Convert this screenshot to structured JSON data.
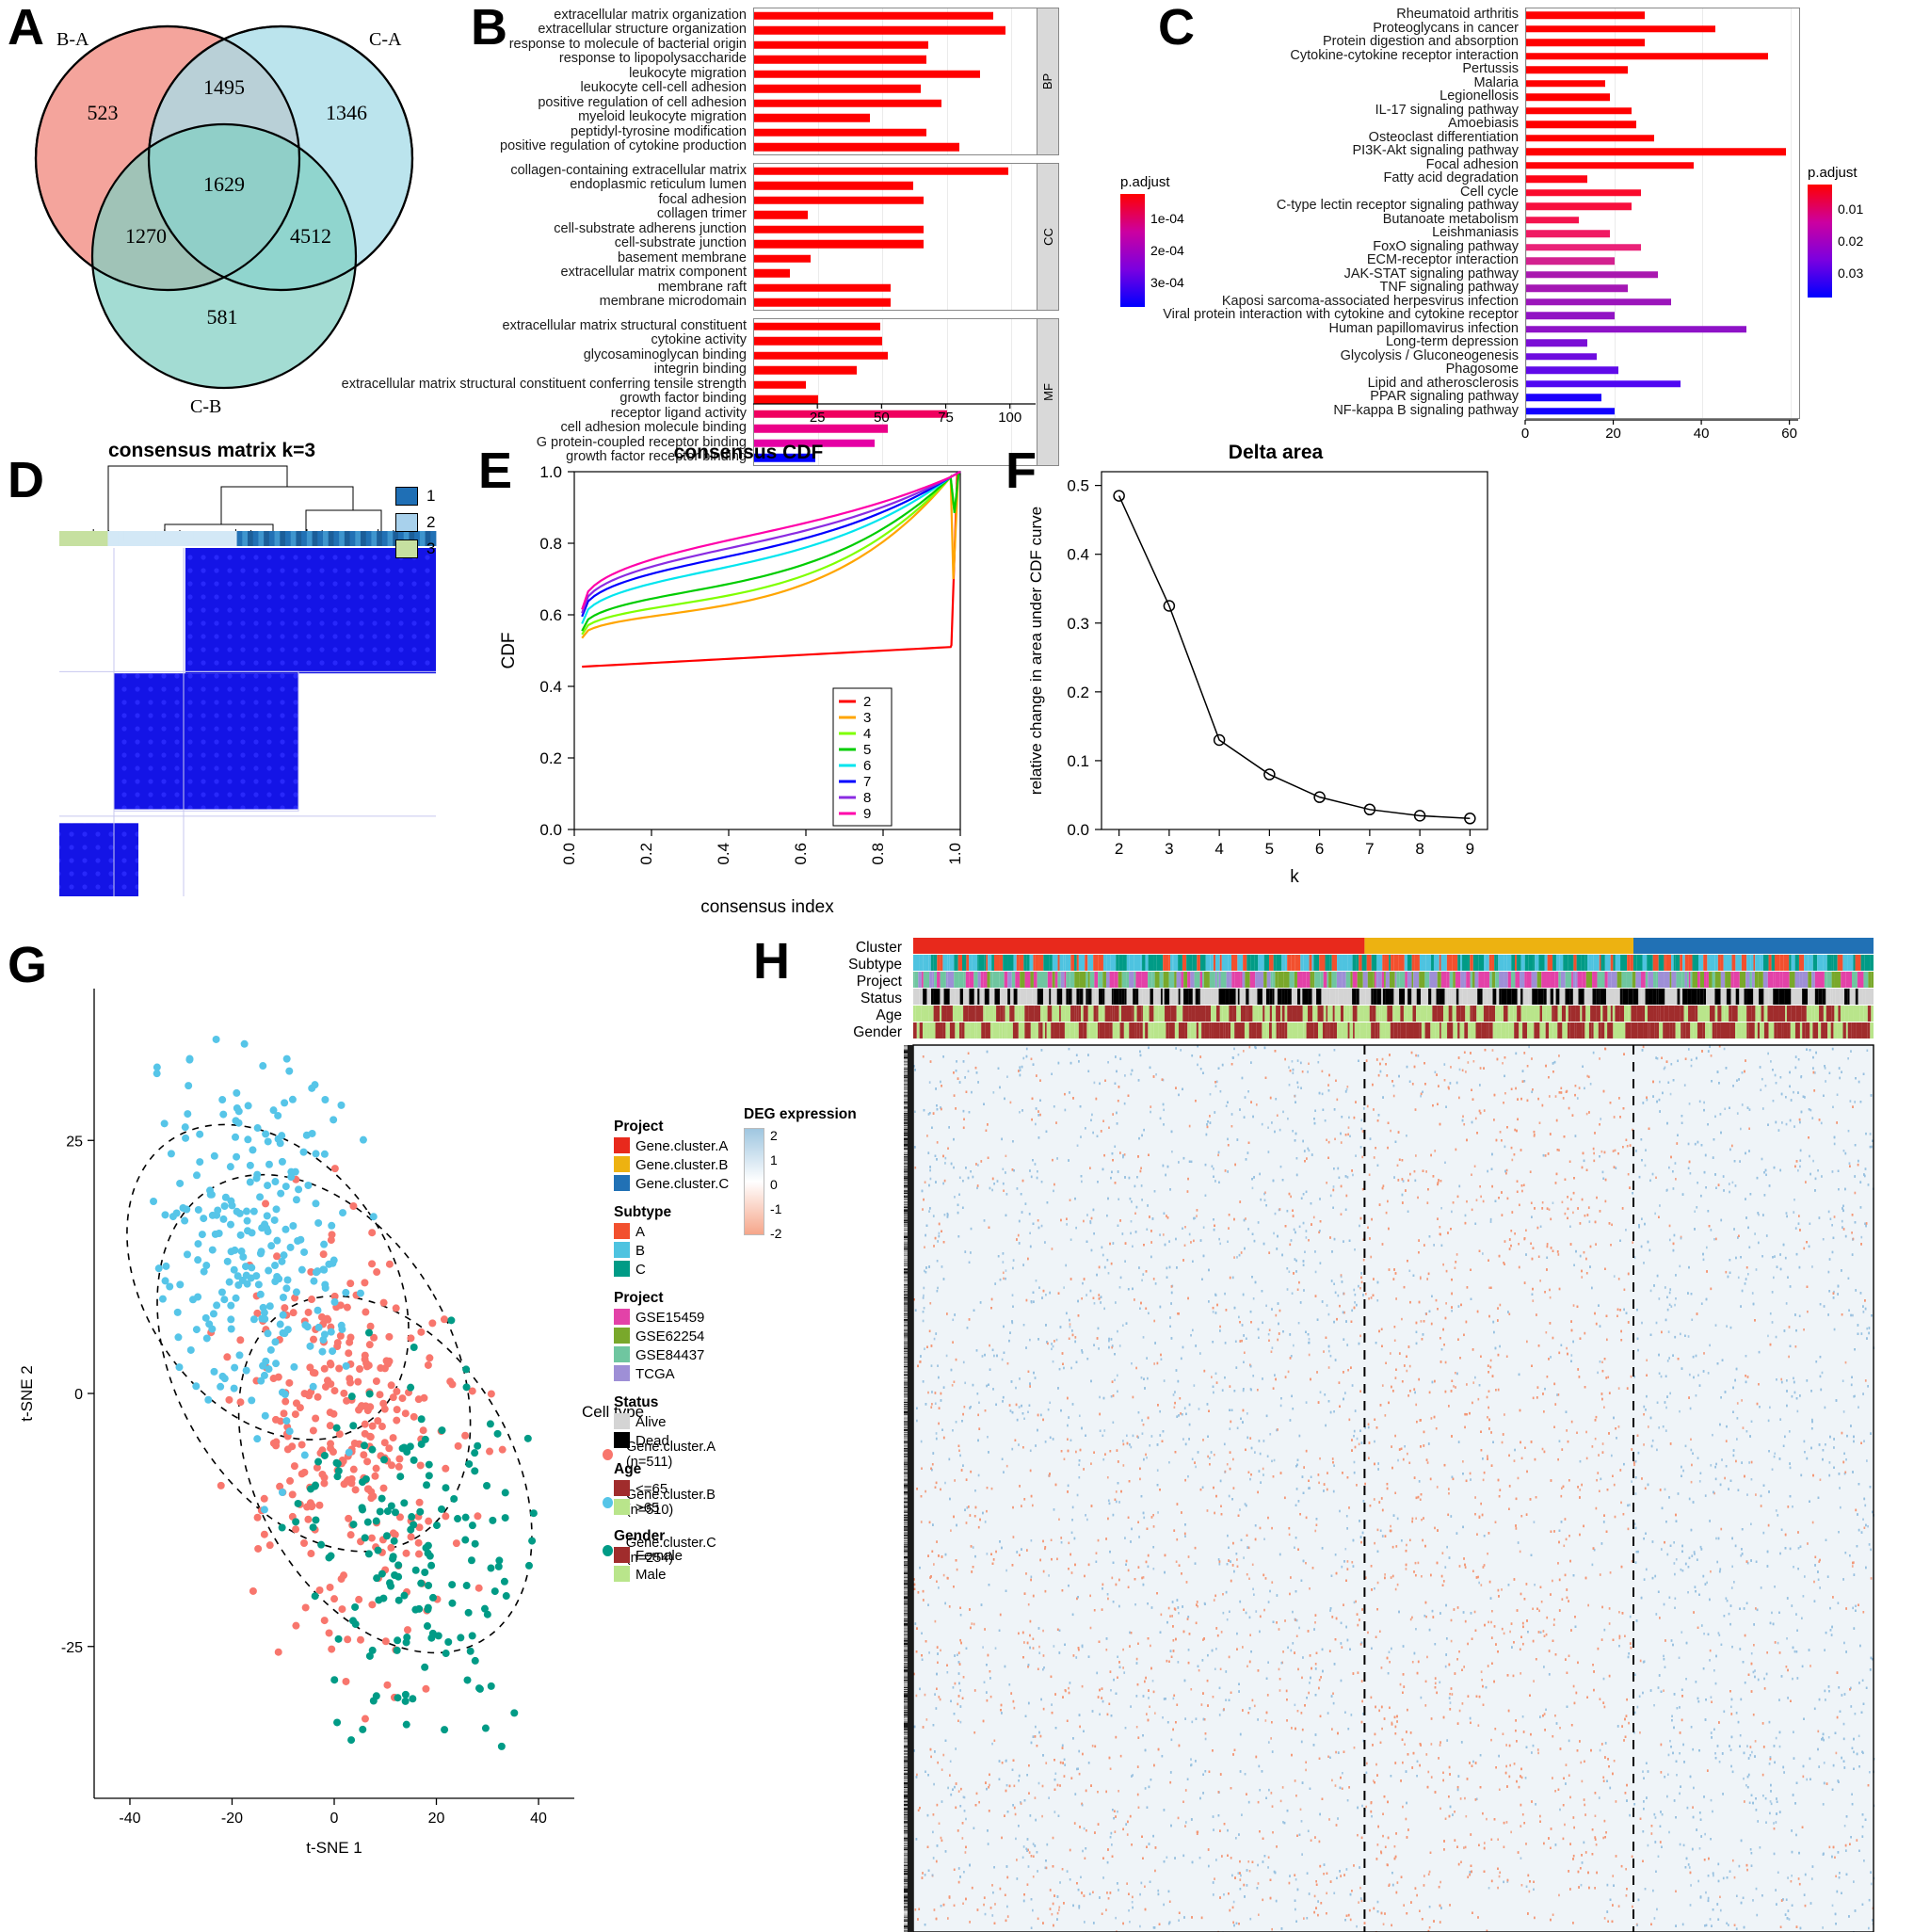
{
  "panels": {
    "A": {
      "label": "A"
    },
    "B": {
      "label": "B"
    },
    "C": {
      "label": "C"
    },
    "D": {
      "label": "D"
    },
    "E": {
      "label": "E"
    },
    "F": {
      "label": "F"
    },
    "G": {
      "label": "G"
    },
    "H": {
      "label": "H"
    }
  },
  "venn": {
    "set_labels": [
      "B-A",
      "C-A",
      "C-B"
    ],
    "values": {
      "only_BA": "523",
      "only_CA": "1346",
      "only_CB": "581",
      "BA_CA": "1495",
      "BA_CB": "1270",
      "CA_CB": "4512",
      "all_three": "1629"
    },
    "colors": {
      "BA": "#F2948B",
      "CA": "#A8DCE8",
      "CB": "#7FCFC2"
    }
  },
  "chart_data": [
    {
      "id": "panelB",
      "type": "bar",
      "title": "",
      "xlabel": "",
      "ylabel": "",
      "xlim": [
        0,
        110
      ],
      "xticks": [
        25,
        50,
        75,
        100
      ],
      "grid": true,
      "legend": {
        "title": "p.adjust",
        "position": "right",
        "ticks": [
          "1e-04",
          "2e-04",
          "3e-04"
        ],
        "colors": [
          "#FF0000",
          "#CC00A0",
          "#7B00E0",
          "#0000FF"
        ]
      },
      "facets": [
        {
          "name": "BP",
          "categories": [
            "extracellular matrix organization",
            "extracellular structure organization",
            "response to molecule of bacterial origin",
            "response to lipopolysaccharide",
            "leukocyte migration",
            "leukocyte cell-cell adhesion",
            "positive regulation of cell adhesion",
            "myeloid leukocyte migration",
            "peptidyl-tyrosine modification",
            "positive regulation of cytokine production"
          ],
          "values": [
            93,
            98,
            68,
            67,
            88,
            65,
            73,
            45,
            67,
            80
          ],
          "colors": [
            "#FF0000",
            "#FF0000",
            "#FF0000",
            "#FF0000",
            "#FF0000",
            "#FF0000",
            "#FF0000",
            "#FF0000",
            "#FF0000",
            "#FF0000"
          ]
        },
        {
          "name": "CC",
          "categories": [
            "collagen-containing extracellular matrix",
            "endoplasmic reticulum lumen",
            "focal adhesion",
            "collagen trimer",
            "cell-substrate adherens junction",
            "cell-substrate junction",
            "basement membrane",
            "extracellular matrix component",
            "membrane raft",
            "membrane microdomain"
          ],
          "values": [
            99,
            62,
            66,
            21,
            66,
            66,
            22,
            14,
            53,
            53
          ],
          "colors": [
            "#FF0000",
            "#FF0000",
            "#FF0000",
            "#FF0000",
            "#FF0000",
            "#FF0000",
            "#FF0000",
            "#FF0000",
            "#FF0000",
            "#FF0000"
          ]
        },
        {
          "name": "MF",
          "categories": [
            "extracellular matrix structural constituent",
            "cytokine activity",
            "glycosaminoglycan binding",
            "integrin binding",
            "extracellular matrix structural constituent conferring tensile strength",
            "growth factor binding",
            "receptor ligand activity",
            "cell adhesion molecule binding",
            "G protein-coupled receptor binding",
            "growth factor receptor binding"
          ],
          "values": [
            49,
            50,
            52,
            40,
            20,
            25,
            75,
            52,
            47,
            24
          ],
          "colors": [
            "#FF0000",
            "#FF0000",
            "#FF0000",
            "#FF0000",
            "#FF0000",
            "#FF0000",
            "#F0005F",
            "#EB0088",
            "#E500A5",
            "#0000FF"
          ]
        }
      ]
    },
    {
      "id": "panelC",
      "type": "bar",
      "title": "",
      "xlabel": "",
      "xlim": [
        0,
        62
      ],
      "xticks": [
        0,
        20,
        40,
        60
      ],
      "grid": true,
      "legend": {
        "title": "p.adjust",
        "position": "right",
        "ticks": [
          "0.01",
          "0.02",
          "0.03"
        ],
        "colors": [
          "#FF0000",
          "#CC00A0",
          "#7B00E0",
          "#0000FF"
        ]
      },
      "categories": [
        "Rheumatoid arthritis",
        "Proteoglycans in cancer",
        "Protein digestion and absorption",
        "Cytokine-cytokine receptor interaction",
        "Pertussis",
        "Malaria",
        "Legionellosis",
        "IL-17 signaling pathway",
        "Amoebiasis",
        "Osteoclast differentiation",
        "PI3K-Akt signaling pathway",
        "Focal adhesion",
        "Fatty acid degradation",
        "Cell cycle",
        "C-type lectin receptor signaling pathway",
        "Butanoate metabolism",
        "Leishmaniasis",
        "FoxO signaling pathway",
        "ECM-receptor interaction",
        "JAK-STAT signaling pathway",
        "TNF signaling pathway",
        "Kaposi sarcoma-associated herpesvirus infection",
        "Viral protein interaction with cytokine and cytokine receptor",
        "Human papillomavirus infection",
        "Long-term depression",
        "Glycolysis / Gluconeogenesis",
        "Phagosome",
        "Lipid and atherosclerosis",
        "PPAR signaling pathway",
        "NF-kappa B signaling pathway"
      ],
      "values": [
        27,
        43,
        27,
        55,
        23,
        18,
        19,
        24,
        25,
        29,
        59,
        38,
        14,
        26,
        24,
        12,
        19,
        26,
        20,
        30,
        23,
        33,
        20,
        50,
        14,
        16,
        21,
        35,
        17,
        20
      ],
      "colors": [
        "#FF0000",
        "#FF0000",
        "#FF0000",
        "#FF0000",
        "#FF0000",
        "#FF0000",
        "#FF0000",
        "#FF0000",
        "#FF0000",
        "#FF0000",
        "#FF0000",
        "#FF0207",
        "#FE0415",
        "#FA0A2C",
        "#F70F3D",
        "#F4144E",
        "#F01963",
        "#EA2278",
        "#D3218F",
        "#A918AF",
        "#A417B4",
        "#9B15BB",
        "#9113C4",
        "#8E12C7",
        "#7A0ED6",
        "#6E0CDF",
        "#5F09E9",
        "#4F06F2",
        "#1B00FB",
        "#1200FF"
      ]
    },
    {
      "id": "panelE",
      "type": "line",
      "title": "consensus CDF",
      "xlabel": "consensus index",
      "ylabel": "CDF",
      "xlim": [
        0,
        1
      ],
      "ylim": [
        0,
        1
      ],
      "xticks": [
        "0.0",
        "0.2",
        "0.4",
        "0.6",
        "0.8",
        "1.0"
      ],
      "yticks": [
        "0.0",
        "0.2",
        "0.4",
        "0.6",
        "0.8",
        "1.0"
      ],
      "legend": {
        "position": "bottom-right",
        "entries": [
          "2",
          "3",
          "4",
          "5",
          "6",
          "7",
          "8",
          "9"
        ],
        "colors": [
          "#FF0000",
          "#FFA500",
          "#7FFF00",
          "#00CC00",
          "#00E5EE",
          "#0000FF",
          "#8A2BE2",
          "#FF00AA"
        ]
      }
    },
    {
      "id": "panelF",
      "type": "line",
      "title": "Delta area",
      "xlabel": "k",
      "ylabel": "relative change in area under CDF curve",
      "x": [
        2,
        3,
        4,
        5,
        6,
        7,
        8,
        9
      ],
      "values": [
        0.485,
        0.325,
        0.13,
        0.08,
        0.047,
        0.029,
        0.02,
        0.016
      ],
      "xticks": [
        "2",
        "3",
        "4",
        "5",
        "6",
        "7",
        "8",
        "9"
      ],
      "yticks": [
        "0.0",
        "0.1",
        "0.2",
        "0.3",
        "0.4",
        "0.5"
      ],
      "ylim": [
        0.0,
        0.5
      ]
    },
    {
      "id": "panelG",
      "type": "scatter",
      "xlabel": "t-SNE 1",
      "ylabel": "t-SNE 2",
      "xticks": [
        "-40",
        "-20",
        "0",
        "20",
        "40"
      ],
      "yticks": [
        "-25",
        "0",
        "25"
      ],
      "xlim": [
        -45,
        45
      ],
      "ylim": [
        -38,
        38
      ],
      "legend": {
        "title": "Cell type",
        "entries": [
          {
            "label": "Gene.cluster.A (n=511)",
            "color": "#F8766D"
          },
          {
            "label": "Gene.cluster.B (n=510)",
            "color": "#56C5E8"
          },
          {
            "label": "Gene.cluster.C (n=254)",
            "color": "#009B86"
          }
        ]
      }
    }
  ],
  "panelD": {
    "title": "consensus matrix k=3",
    "legend": [
      {
        "label": "1",
        "color": "#1F6FB5"
      },
      {
        "label": "2",
        "color": "#A8D1EC"
      },
      {
        "label": "3",
        "color": "#C6E0A0"
      }
    ]
  },
  "panelH": {
    "row_labels": [
      "Cluster",
      "Subtype",
      "Project",
      "Status",
      "Age",
      "Gender"
    ],
    "legends": [
      {
        "title": "Project",
        "items": [
          {
            "label": "Gene.cluster.A",
            "color": "#E8291C"
          },
          {
            "label": "Gene.cluster.B",
            "color": "#EDB211"
          },
          {
            "label": "Gene.cluster.C",
            "color": "#2171B5"
          }
        ]
      },
      {
        "title": "Subtype",
        "items": [
          {
            "label": "A",
            "color": "#F2502E"
          },
          {
            "label": "B",
            "color": "#4EC3E0"
          },
          {
            "label": "C",
            "color": "#009B86"
          }
        ]
      },
      {
        "title": "Project",
        "items": [
          {
            "label": "GSE15459",
            "color": "#E342A8"
          },
          {
            "label": "GSE62254",
            "color": "#79A82B"
          },
          {
            "label": "GSE84437",
            "color": "#6FC6A0"
          },
          {
            "label": "TCGA",
            "color": "#9E8FD6"
          }
        ]
      },
      {
        "title": "Status",
        "items": [
          {
            "label": "Alive",
            "color": "#D4D4D4"
          },
          {
            "label": "Dead",
            "color": "#000000"
          }
        ]
      },
      {
        "title": "Age",
        "items": [
          {
            "label": "<=65",
            "color": "#A02C2C"
          },
          {
            "label": ">65",
            "color": "#B9E58B"
          }
        ]
      },
      {
        "title": "Gender",
        "items": [
          {
            "label": "Female",
            "color": "#A02C2C"
          },
          {
            "label": "Male",
            "color": "#B9E58B"
          }
        ]
      }
    ],
    "deg_legend": {
      "title": "DEG expression",
      "ticks": [
        "2",
        "1",
        "0",
        "-1",
        "-2"
      ],
      "high_color": "#9FC6E0",
      "low_color": "#F6A68A"
    }
  }
}
